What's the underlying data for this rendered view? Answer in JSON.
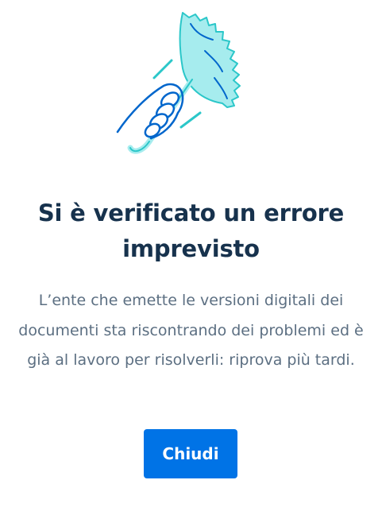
{
  "error_screen": {
    "illustration_icon": "broken-umbrella-icon",
    "title": "Si è verificato un errore imprevisto",
    "message": "L’ente che emette le versioni digitali dei documenti sta riscontrando dei problemi ed è già al lavoro per risolverli: riprova più tardi.",
    "close_label": "Chiudi"
  },
  "colors": {
    "title": "#17324d",
    "message": "#5c6f82",
    "accent": "#0073e6",
    "illustration_fill": "#a6ecee",
    "illustration_line": "#0066cc",
    "illustration_line_light": "#2bc7c9"
  }
}
